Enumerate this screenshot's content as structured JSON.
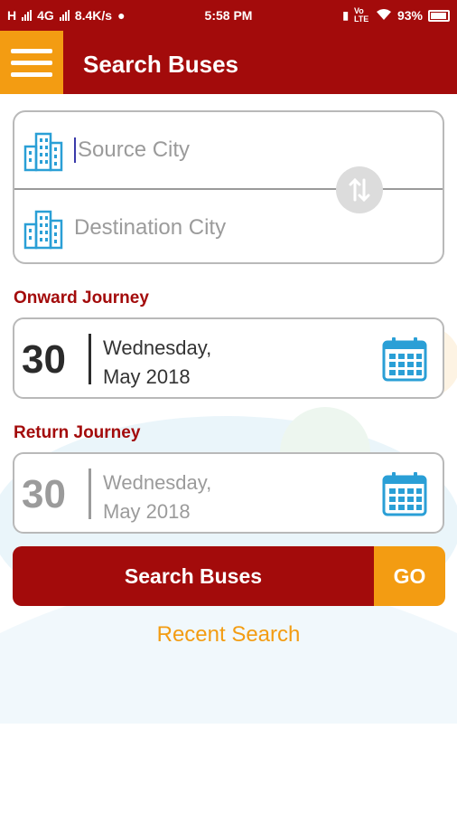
{
  "status_bar": {
    "network_left": "H",
    "network_4g": "4G",
    "speed": "8.4K/s",
    "time": "5:58 PM",
    "volte": "Vo LTE",
    "battery": "93%"
  },
  "app_bar": {
    "title": "Search Buses"
  },
  "route": {
    "source_placeholder": "Source City",
    "destination_placeholder": "Destination City"
  },
  "onward": {
    "label": "Onward Journey",
    "day": "30",
    "weekday": "Wednesday,",
    "month_year": "May 2018"
  },
  "return": {
    "label": "Return Journey",
    "day": "30",
    "weekday": "Wednesday,",
    "month_year": "May 2018"
  },
  "actions": {
    "search_label": "Search Buses",
    "go_label": "GO",
    "recent_label": "Recent Search"
  },
  "colors": {
    "primary": "#a30b0b",
    "accent": "#f39c12",
    "icon_blue": "#2a9fd6"
  },
  "icons": {
    "menu": "hamburger-icon",
    "city": "building-icon",
    "swap": "swap-vertical-icon",
    "calendar": "calendar-icon"
  }
}
